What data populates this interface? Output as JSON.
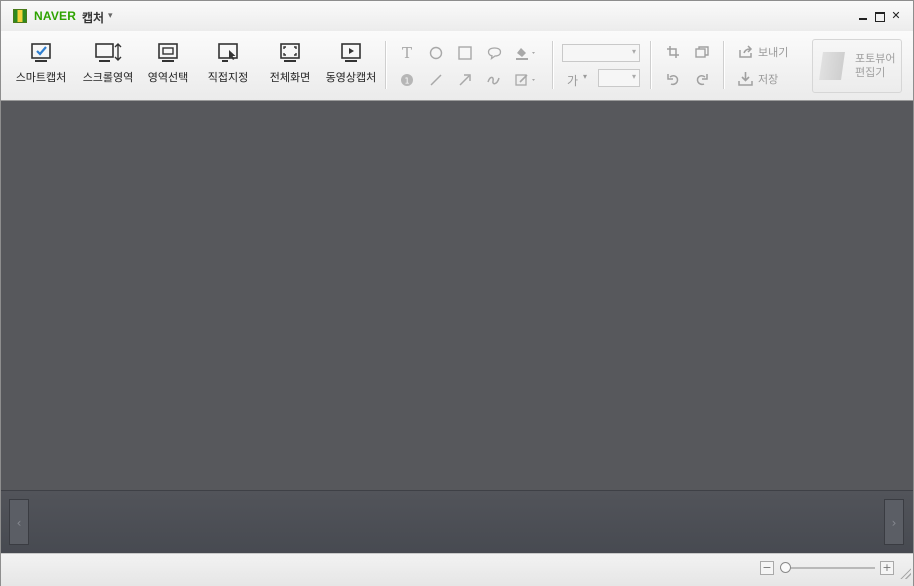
{
  "title": {
    "brand": "NAVER",
    "app_name": "캡처",
    "caret": "▾"
  },
  "window_controls": {
    "minimize": "",
    "maximize": "",
    "close": "✕"
  },
  "capture_tools": [
    {
      "label": "스마트캡처",
      "icon": "smart-capture-icon"
    },
    {
      "label": "스크롤영역",
      "icon": "scroll-area-icon"
    },
    {
      "label": "영역선택",
      "icon": "area-select-icon"
    },
    {
      "label": "직접지정",
      "icon": "manual-select-icon"
    },
    {
      "label": "전체화면",
      "icon": "fullscreen-icon"
    },
    {
      "label": "동영상캡처",
      "icon": "video-capture-icon"
    }
  ],
  "draw_tools": {
    "text": "T",
    "number": "1",
    "font_size_glyph": "가"
  },
  "share": {
    "send_label": "보내기",
    "save_label": "저장"
  },
  "photo_editor": {
    "line1": "포토뷰어",
    "line2": "편집기"
  },
  "thumbnail_nav": {
    "prev": "‹",
    "next": "›"
  },
  "zoom": {
    "minus": "−",
    "plus": "+",
    "level": 0
  },
  "colors": {
    "brand_green": "#2ea300",
    "canvas": "#57585c",
    "icon_blue": "#2f7fd0"
  }
}
